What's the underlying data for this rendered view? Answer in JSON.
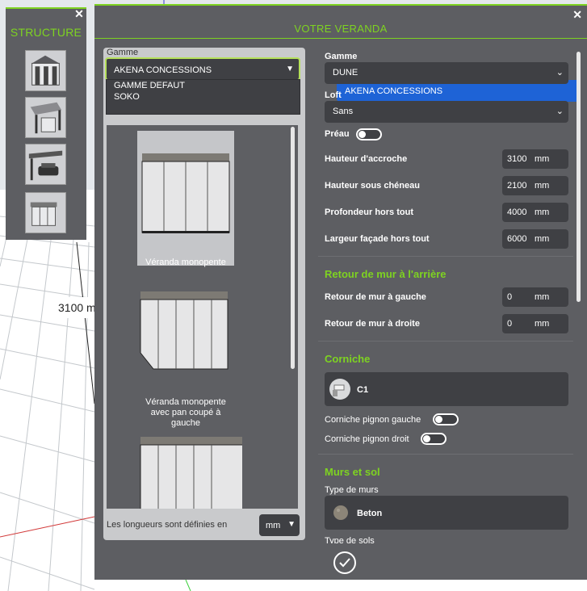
{
  "scene": {
    "dimension_label": "3100 m"
  },
  "structure_panel": {
    "title": "STRUCTURE",
    "close": "✕",
    "icons": [
      "veranda-house-icon",
      "pergola-icon",
      "carport-icon",
      "enclosure-icon"
    ]
  },
  "main_panel": {
    "title": "VOTRE VERANDA",
    "close": "✕",
    "left": {
      "gamme_label": "Gamme",
      "gamme_value": "AKENA CONCESSIONS",
      "gamme_options": [
        "AKENA CONCESSIONS",
        "GAMME DEFAUT",
        "SOKO"
      ],
      "models": [
        {
          "caption": "Véranda monopente"
        },
        {
          "caption": "Véranda monopente avec pan coupé à gauche"
        },
        {
          "caption": ""
        }
      ],
      "units_label": "Les longueurs sont définies en",
      "units_value": "mm"
    },
    "right": {
      "gamme_label": "Gamme",
      "gamme_value": "DUNE",
      "loft_label": "Loft",
      "loft_value": "Sans",
      "preau_label": "Préau",
      "preau_on": false,
      "dimensions": [
        {
          "label": "Hauteur d'accroche",
          "value": "3100",
          "unit": "mm"
        },
        {
          "label": "Hauteur sous chéneau",
          "value": "2100",
          "unit": "mm"
        },
        {
          "label": "Profondeur hors tout",
          "value": "4000",
          "unit": "mm"
        },
        {
          "label": "Largeur façade hors tout",
          "value": "6000",
          "unit": "mm"
        }
      ],
      "retour_section": "Retour de mur à l'arrière",
      "retour": [
        {
          "label": "Retour de mur à gauche",
          "value": "0",
          "unit": "mm"
        },
        {
          "label": "Retour de mur à droite",
          "value": "0",
          "unit": "mm"
        }
      ],
      "corniche_section": "Corniche",
      "corniche_value": "C1",
      "corniche_pignon_gauche": "Corniche pignon gauche",
      "corniche_pignon_droit": "Corniche pignon droit",
      "murs_section": "Murs et sol",
      "type_murs_label": "Type de murs",
      "type_murs_value": "Beton",
      "type_sols_label": "Type de sols"
    }
  },
  "colors": {
    "accent": "#7ed321",
    "panel": "#5d5e62",
    "field": "#3f4044",
    "selection": "#1e63d6"
  }
}
